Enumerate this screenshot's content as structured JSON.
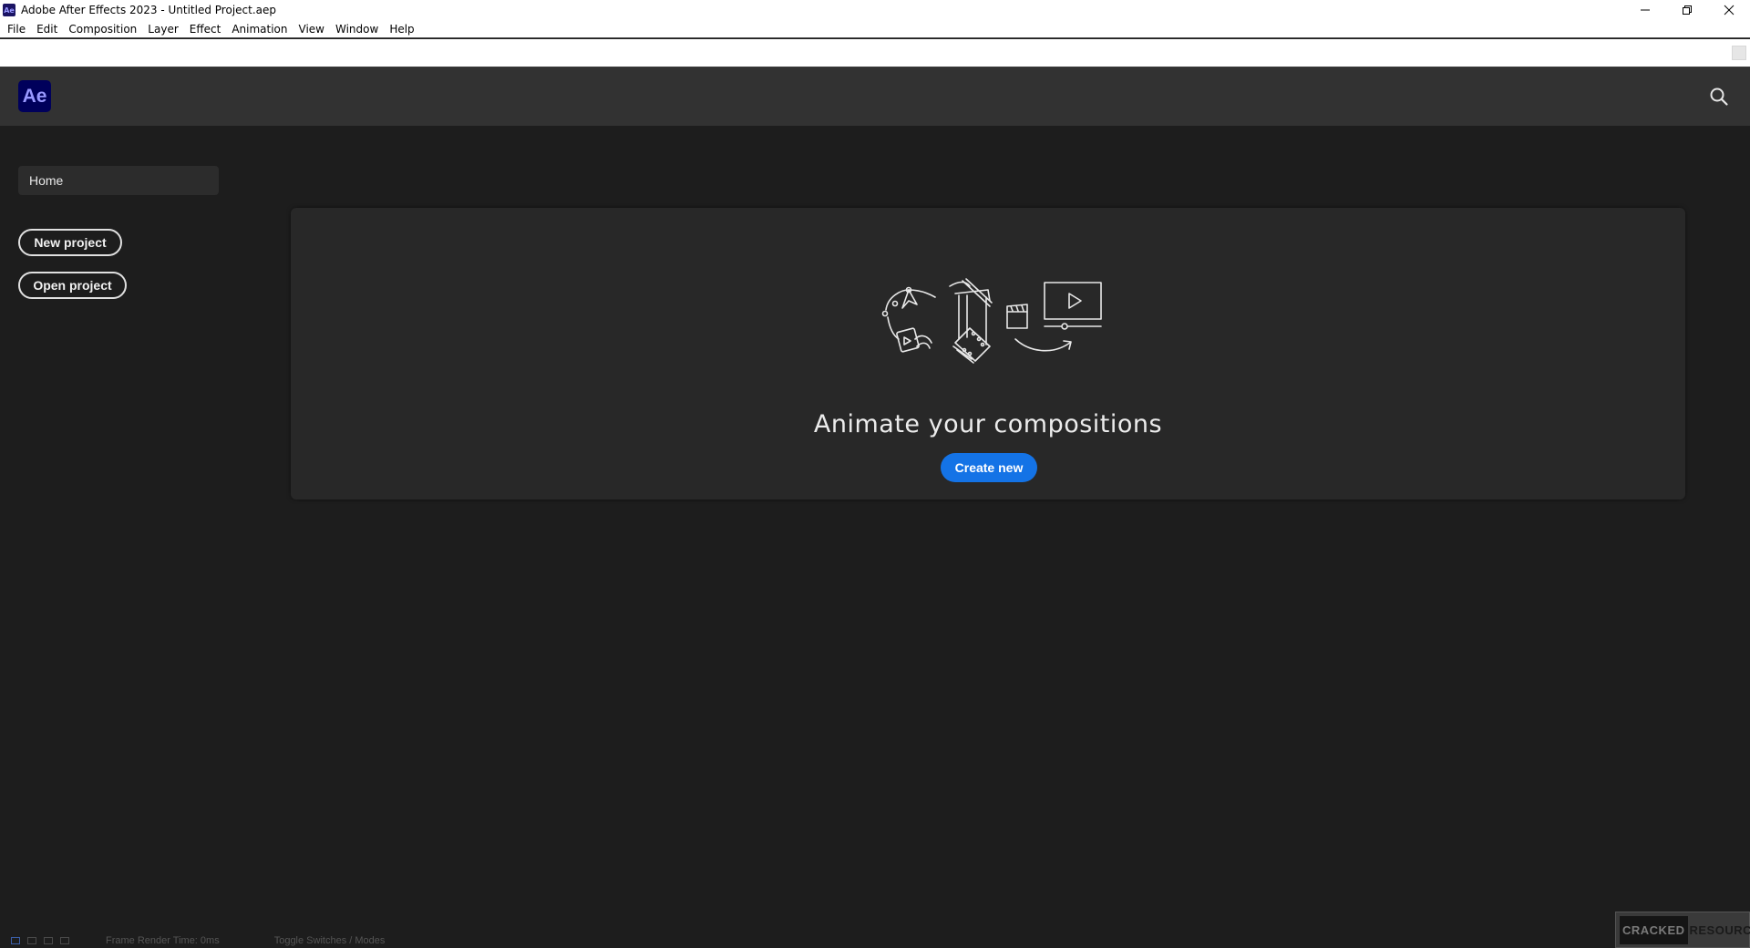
{
  "window": {
    "title": "Adobe After Effects 2023 - Untitled Project.aep",
    "app_icon_text": "Ae",
    "controls": {
      "minimize": "minimize-icon",
      "restore": "restore-icon",
      "close": "close-icon"
    }
  },
  "menubar": {
    "items": [
      "File",
      "Edit",
      "Composition",
      "Layer",
      "Effect",
      "Animation",
      "View",
      "Window",
      "Help"
    ]
  },
  "header": {
    "logo_text": "Ae",
    "search_icon": "search-icon"
  },
  "sidebar": {
    "home_label": "Home",
    "new_project_label": "New project",
    "open_project_label": "Open project"
  },
  "main": {
    "illustration": "animation-workflow-illustration",
    "headline": "Animate your compositions",
    "create_new_label": "Create new"
  },
  "status_bar": {
    "left_text": "Frame Render Time: 0ms",
    "right_text": "Toggle Switches / Modes"
  },
  "watermark": {
    "part1": "CRACKED",
    "part2": "RESOURCE"
  },
  "colors": {
    "accent": "#1473e6",
    "ae_logo_bg": "#00005b",
    "ae_logo_text": "#9999ff",
    "header_bg": "#323232",
    "body_bg": "#1d1d1d",
    "panel_bg": "#282828"
  }
}
